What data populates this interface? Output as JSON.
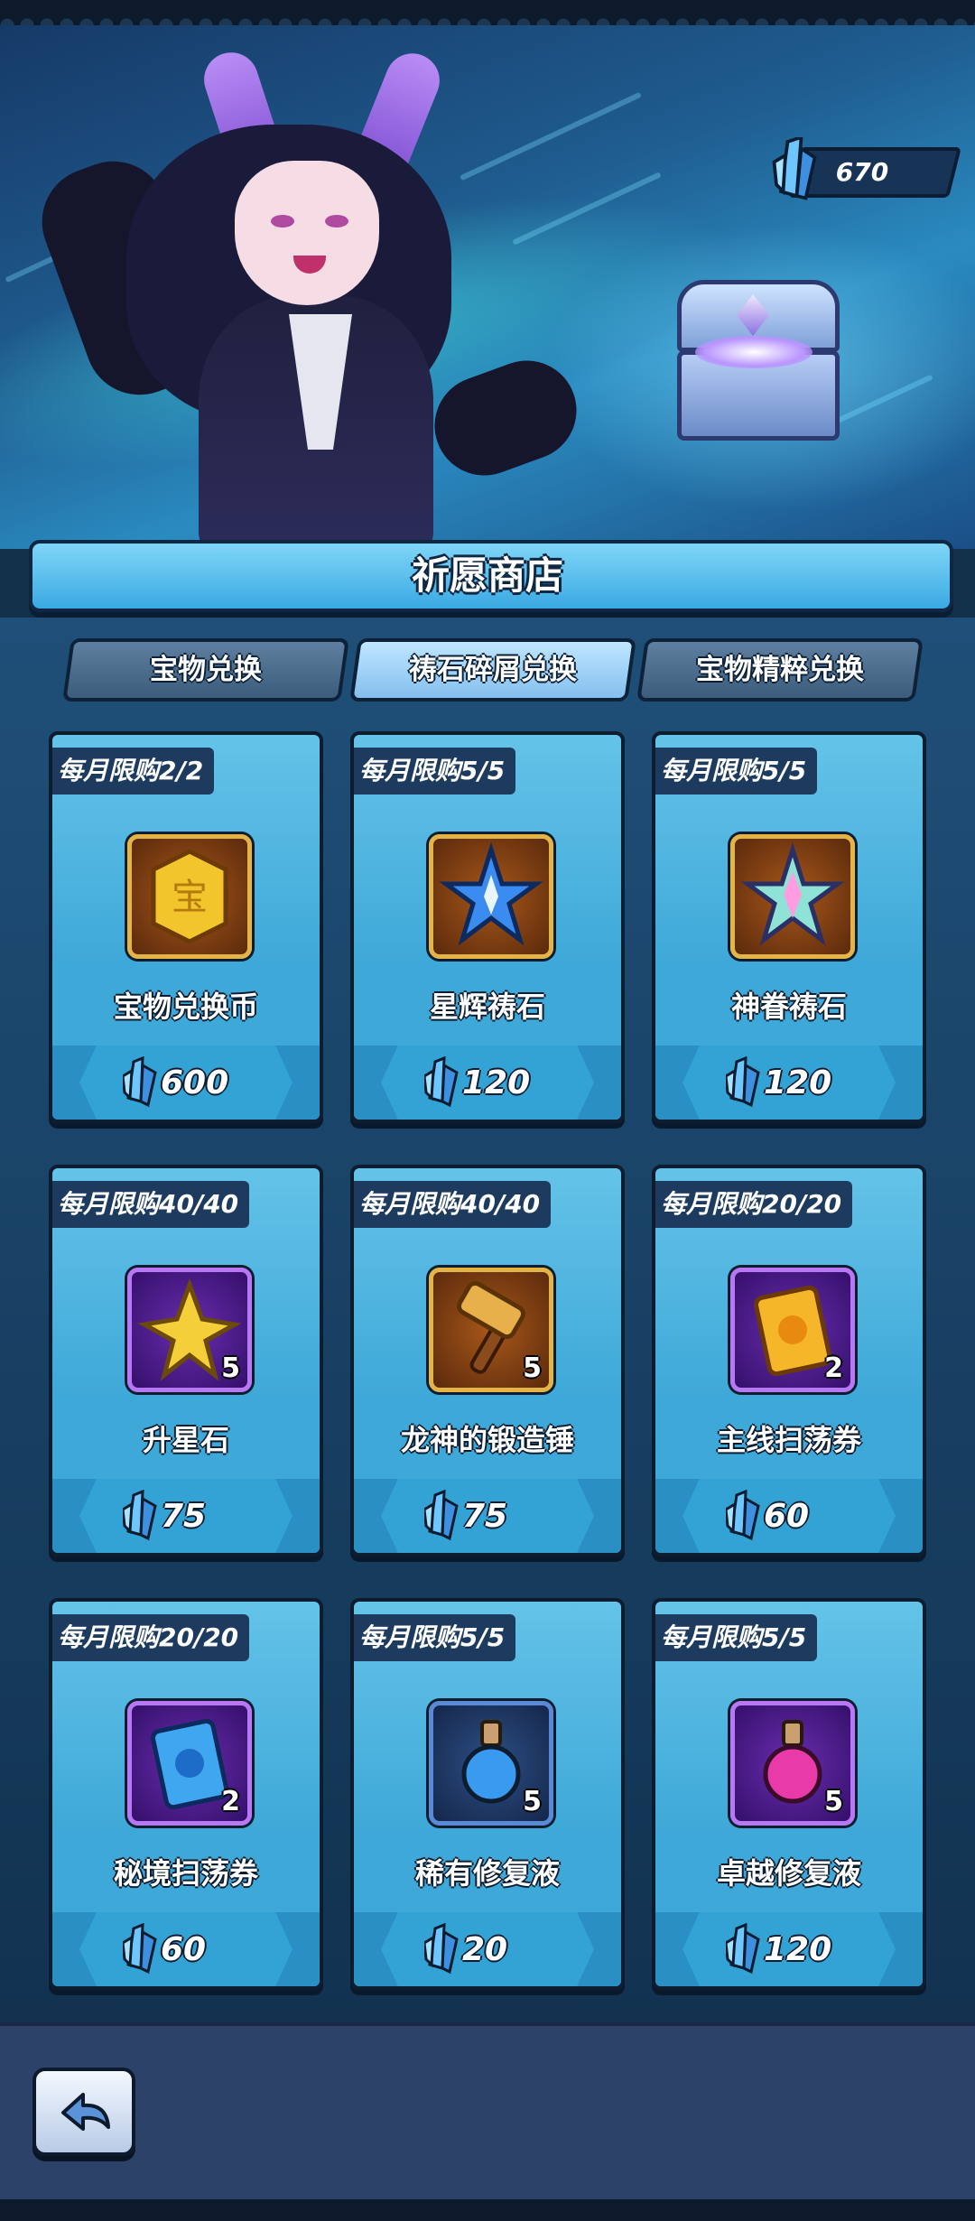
{
  "currency": {
    "value": "670",
    "icon": "blue-crystal-icon"
  },
  "shop": {
    "title": "祈愿商店",
    "tabs": [
      {
        "label": "宝物兑换",
        "active": false
      },
      {
        "label": "祷石碎屑兑换",
        "active": true
      },
      {
        "label": "宝物精粹兑换",
        "active": false
      }
    ],
    "items": [
      {
        "limit": "每月限购2/2",
        "name": "宝物兑换币",
        "price": "600",
        "qty": "",
        "icon": "treasure-coin-icon",
        "frame": "brown"
      },
      {
        "limit": "每月限购5/5",
        "name": "星辉祷石",
        "price": "120",
        "qty": "",
        "icon": "starlight-stone-icon",
        "frame": "brown"
      },
      {
        "limit": "每月限购5/5",
        "name": "神眷祷石",
        "price": "120",
        "qty": "",
        "icon": "divine-stone-icon",
        "frame": "brown"
      },
      {
        "limit": "每月限购40/40",
        "name": "升星石",
        "price": "75",
        "qty": "5",
        "icon": "star-stone-icon",
        "frame": "purple"
      },
      {
        "limit": "每月限购40/40",
        "name": "龙神的锻造锤",
        "price": "75",
        "qty": "5",
        "icon": "forge-hammer-icon",
        "frame": "brown"
      },
      {
        "limit": "每月限购20/20",
        "name": "主线扫荡券",
        "price": "60",
        "qty": "2",
        "icon": "main-sweep-ticket-icon",
        "frame": "purple"
      },
      {
        "limit": "每月限购20/20",
        "name": "秘境扫荡券",
        "price": "60",
        "qty": "2",
        "icon": "secret-sweep-ticket-icon",
        "frame": "purple"
      },
      {
        "limit": "每月限购5/5",
        "name": "稀有修复液",
        "price": "20",
        "qty": "5",
        "icon": "blue-potion-icon",
        "frame": "navy"
      },
      {
        "limit": "每月限购5/5",
        "name": "卓越修复液",
        "price": "120",
        "qty": "5",
        "icon": "pink-potion-icon",
        "frame": "purple"
      }
    ]
  },
  "footer": {
    "back_icon": "back-arrow-icon"
  },
  "colors": {
    "accent": "#3aa9e3",
    "panel": "#1f4f78",
    "crystal": "#6fc6ff"
  }
}
